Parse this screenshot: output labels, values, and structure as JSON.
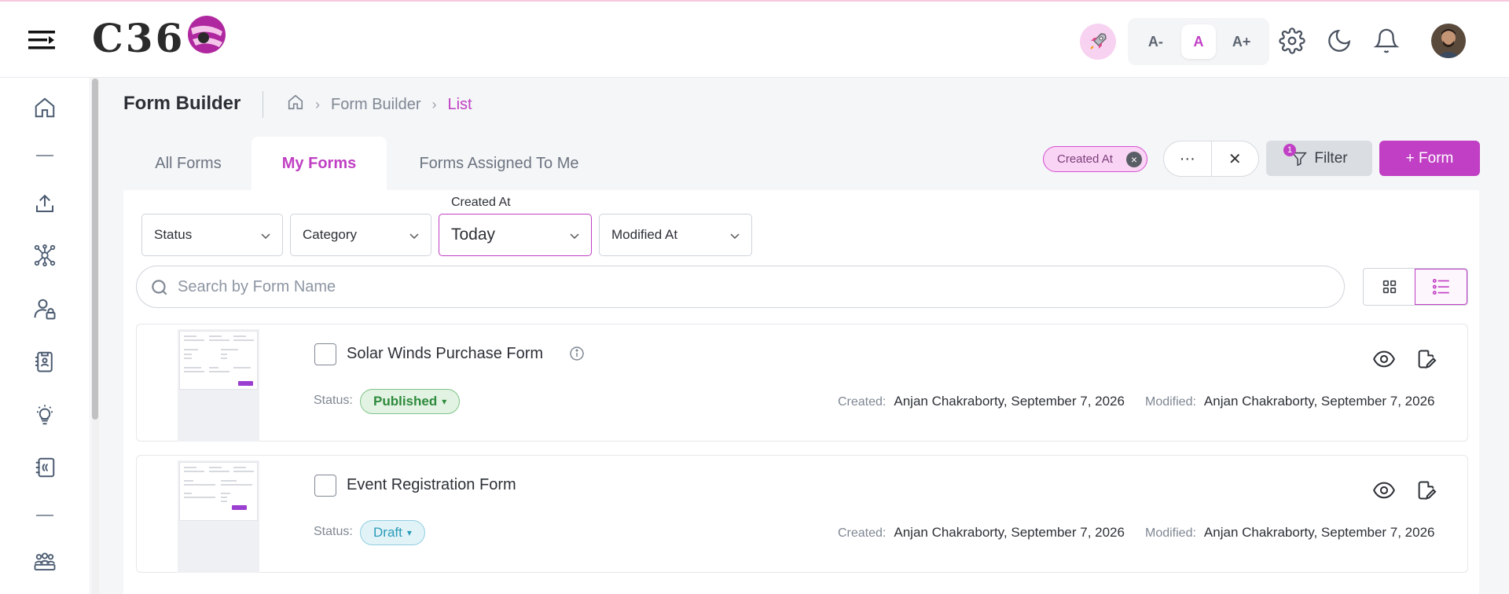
{
  "app": {
    "logo_text": "C36"
  },
  "header": {
    "font_controls": [
      "A-",
      "A",
      "A+"
    ]
  },
  "page": {
    "title": "Form Builder",
    "breadcrumb": [
      "Form Builder",
      "List"
    ]
  },
  "tabs": [
    "All Forms",
    "My Forms",
    "Forms Assigned To Me"
  ],
  "toolbar": {
    "active_chip": "Created At",
    "more_label": "···",
    "clear_label": "✕",
    "filter_label": "Filter",
    "filter_count": "1",
    "add_form_label": "+ Form"
  },
  "filters": {
    "status": "Status",
    "category": "Category",
    "created_at_label": "Created At",
    "created_at_value": "Today",
    "modified_at": "Modified At"
  },
  "search": {
    "placeholder": "Search by Form Name"
  },
  "forms": [
    {
      "name": "Solar Winds Purchase Form",
      "status_label": "Status:",
      "status": "Published",
      "created_label": "Created:",
      "created": "Anjan Chakraborty, September 7, 2026",
      "modified_label": "Modified:",
      "modified": "Anjan Chakraborty, September 7, 2026"
    },
    {
      "name": "Event Registration Form",
      "status_label": "Status:",
      "status": "Draft",
      "created_label": "Created:",
      "created": "Anjan Chakraborty, September 7, 2026",
      "modified_label": "Modified:",
      "modified": "Anjan Chakraborty, September 7, 2026"
    }
  ],
  "colors": {
    "accent": "#c03fc4",
    "published": "#2e8a3b",
    "draft": "#2a9bb8"
  }
}
